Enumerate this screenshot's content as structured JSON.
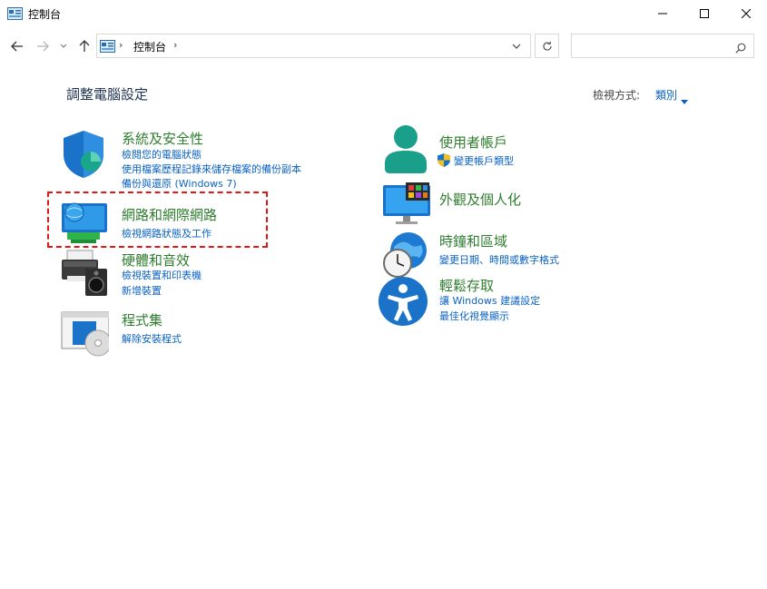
{
  "window": {
    "title": "控制台"
  },
  "address": {
    "crumb": "控制台",
    "search_placeholder": ""
  },
  "content": {
    "title": "調整電腦設定",
    "view_by_label": "檢視方式:",
    "view_by_value": "類別"
  },
  "categories": {
    "system_security": {
      "title": "系統及安全性",
      "links": [
        "檢閱您的電腦狀態",
        "使用檔案歷程記錄來儲存檔案的備份副本",
        "備份與還原 (Windows 7)"
      ]
    },
    "network": {
      "title": "網路和網際網路",
      "links": [
        "檢視網路狀態及工作"
      ]
    },
    "hardware": {
      "title": "硬體和音效",
      "links": [
        "檢視裝置和印表機",
        "新增裝置"
      ]
    },
    "programs": {
      "title": "程式集",
      "links": [
        "解除安裝程式"
      ]
    },
    "user_accounts": {
      "title": "使用者帳戶",
      "links": [
        "變更帳戶類型"
      ]
    },
    "appearance": {
      "title": "外觀及個人化",
      "links": []
    },
    "clock_region": {
      "title": "時鐘和區域",
      "links": [
        "變更日期、時間或數字格式"
      ]
    },
    "ease_of_access": {
      "title": "輕鬆存取",
      "links": [
        "讓 Windows 建議設定",
        "最佳化視覺顯示"
      ]
    }
  },
  "colors": {
    "category_title": "#2f7d2f",
    "link": "#0b62c4",
    "highlight": "#e01818"
  }
}
